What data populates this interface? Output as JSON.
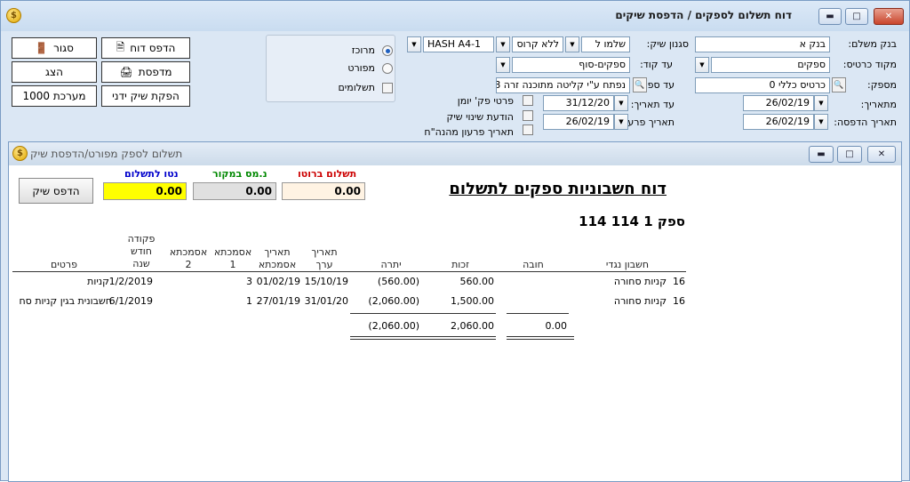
{
  "window": {
    "title": "דוח תשלום לספקים / הדפסת שיקים"
  },
  "buttons": {
    "print_report": "הדפס דוח",
    "close": "סגור",
    "printer": "מדפסת",
    "show": "הצג",
    "manual_check": "הפקת שיק ידני",
    "system": "מערכת 1000"
  },
  "options": {
    "merged": "מרוכז",
    "detailed": "מפורט",
    "payments": "תשלומים",
    "selected": "merged"
  },
  "filters": {
    "bank_label": "בנק משלם:",
    "bank_value": "בנק א",
    "check_style_label": "סגנון שיק:",
    "check_style_value": "שלמו ל",
    "cross_value": "ללא קרוס",
    "format_value": "HASH A4-1",
    "card_code_label": "מקוד כרטיס:",
    "card_code_value": "ספקים",
    "to_code_label": "עד קוד:",
    "to_code_value": "ספקים-סוף",
    "from_number_label": "מספק:",
    "from_number_value": "כרטיס כללי 0",
    "to_supplier_label": "עד ספק:",
    "to_supplier_value": "נפתח ע\"י קליטה מתוכנה זרה 8",
    "from_date_label": "מתאריך:",
    "from_date_value": "26/02/19",
    "to_date_label": "עד תאריך:",
    "to_date_value": "31/12/20",
    "print_date_label": "תאריך הדפסה:",
    "print_date_value": "26/02/19",
    "redeem_date_label": "תאריך פרעון:",
    "redeem_date_value": "26/02/19",
    "journal_details": "פרטי פק' יומן",
    "check_change_notice": "הודעת שינוי שיק",
    "redeem_date_from_vat": "תאריך פרעון מהנה\"ח"
  },
  "inner": {
    "title": "תשלום לספק מפורט/הדפסת שיק",
    "print_check": "הדפס שיק",
    "net_label": "נטו לתשלום",
    "net_value": "0.00",
    "tax_label": "נ.מס במקור",
    "tax_value": "0.00",
    "gross_label": "תשלום ברוטו",
    "gross_value": "0.00",
    "colors": {
      "net_bg": "#ffff00",
      "tax_bg": "#e0e0e0",
      "gross_bg": "#fff3e3",
      "net_text": "#0000cc",
      "tax_text": "#008800",
      "gross_text": "#cc0000"
    }
  },
  "report": {
    "title": "דוח חשבוניות ספקים לתשלום",
    "supplier": "ספק 1 114 114",
    "headers": {
      "counter_account": "חשבון נגדי",
      "debit": "חובה",
      "credit": "זכות",
      "balance": "יתרה",
      "value_date_1": "תאריך",
      "value_date_2": "ערך",
      "ref_date_1": "תאריך",
      "ref_date_2": "אסמכתא",
      "ref1_1": "אסמכתא",
      "ref1_2": "1",
      "ref2_1": "אסמכתא",
      "ref2_2": "2",
      "order_1": "פקודה",
      "order_2": "חודש",
      "order_3": "שנה",
      "details": "פרטים"
    },
    "rows": [
      {
        "account": "16",
        "account_name": "קניות סחורה",
        "debit": "",
        "credit": "560.00",
        "balance": "(560.00)",
        "value_date": "15/10/19",
        "ref_date": "01/02/19",
        "ref1": "3",
        "ref2": "",
        "order": "1/2/2019",
        "details": "קניות"
      },
      {
        "account": "16",
        "account_name": "קניות סחורה",
        "debit": "",
        "credit": "1,500.00",
        "balance": "(2,060.00)",
        "value_date": "31/01/20",
        "ref_date": "27/01/19",
        "ref1": "1",
        "ref2": "",
        "order": "6/1/2019",
        "details": "חשבונית בגין קניות סח"
      }
    ],
    "totals": {
      "debit": "0.00",
      "credit": "2,060.00",
      "balance": "(2,060.00)"
    }
  }
}
